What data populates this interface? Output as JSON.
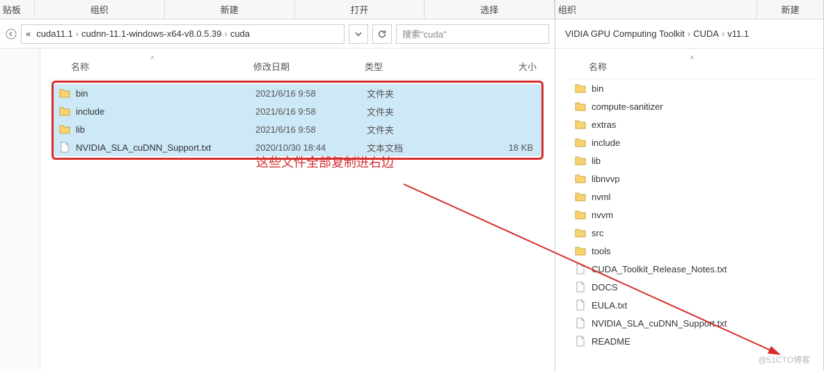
{
  "left": {
    "ribbon": [
      "贴板",
      "组织",
      "新建",
      "打开",
      "选择"
    ],
    "breadcrumb_prefix": "«",
    "breadcrumb": [
      "cuda11.1",
      "cudnn-11.1-windows-x64-v8.0.5.39",
      "cuda"
    ],
    "search_placeholder": "搜索\"cuda\"",
    "columns": {
      "name": "名称",
      "date": "修改日期",
      "type": "类型",
      "size": "大小"
    },
    "rows": [
      {
        "name": "bin",
        "date": "2021/6/16 9:58",
        "type": "文件夹",
        "size": "",
        "kind": "folder",
        "selected": true
      },
      {
        "name": "include",
        "date": "2021/6/16 9:58",
        "type": "文件夹",
        "size": "",
        "kind": "folder",
        "selected": true
      },
      {
        "name": "lib",
        "date": "2021/6/16 9:58",
        "type": "文件夹",
        "size": "",
        "kind": "folder",
        "selected": true
      },
      {
        "name": "NVIDIA_SLA_cuDNN_Support.txt",
        "date": "2020/10/30 18:44",
        "type": "文本文档",
        "size": "18 KB",
        "kind": "file",
        "selected": true
      }
    ],
    "annotation": "这些文件全部复制进右边"
  },
  "right": {
    "ribbon": [
      "组织",
      "新建"
    ],
    "breadcrumb": [
      "VIDIA GPU Computing Toolkit",
      "CUDA",
      "v11.1"
    ],
    "columns": {
      "name": "名称"
    },
    "rows": [
      {
        "name": "bin",
        "kind": "folder"
      },
      {
        "name": "compute-sanitizer",
        "kind": "folder"
      },
      {
        "name": "extras",
        "kind": "folder"
      },
      {
        "name": "include",
        "kind": "folder"
      },
      {
        "name": "lib",
        "kind": "folder"
      },
      {
        "name": "libnvvp",
        "kind": "folder"
      },
      {
        "name": "nvml",
        "kind": "folder"
      },
      {
        "name": "nvvm",
        "kind": "folder"
      },
      {
        "name": "src",
        "kind": "folder"
      },
      {
        "name": "tools",
        "kind": "folder"
      },
      {
        "name": "CUDA_Toolkit_Release_Notes.txt",
        "kind": "file"
      },
      {
        "name": "DOCS",
        "kind": "file"
      },
      {
        "name": "EULA.txt",
        "kind": "file"
      },
      {
        "name": "NVIDIA_SLA_cuDNN_Support.txt",
        "kind": "file"
      },
      {
        "name": "README",
        "kind": "file"
      }
    ]
  },
  "watermark": "@51CTO博客"
}
